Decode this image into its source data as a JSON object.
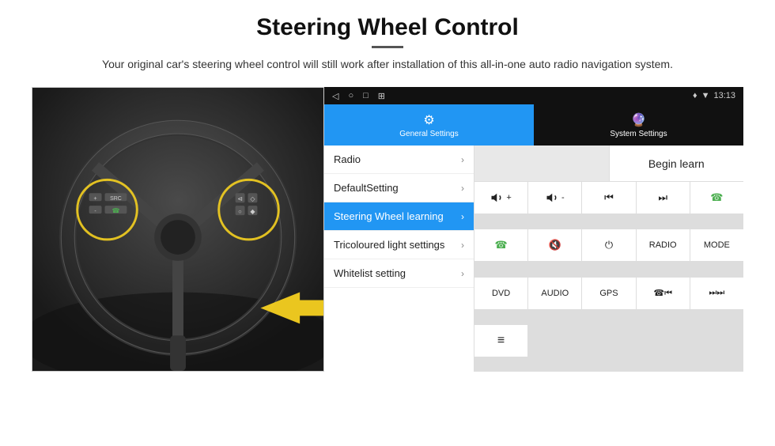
{
  "header": {
    "title": "Steering Wheel Control",
    "subtitle": "Your original car's steering wheel control will still work after installation of this all-in-one auto radio navigation system."
  },
  "status_bar": {
    "time": "13:13",
    "icons": [
      "◁",
      "○",
      "□",
      "⊞"
    ]
  },
  "tabs": [
    {
      "id": "general",
      "label": "General Settings",
      "active": true
    },
    {
      "id": "system",
      "label": "System Settings",
      "active": false
    }
  ],
  "menu_items": [
    {
      "id": "radio",
      "label": "Radio",
      "active": false
    },
    {
      "id": "default",
      "label": "DefaultSetting",
      "active": false
    },
    {
      "id": "steering",
      "label": "Steering Wheel learning",
      "active": true
    },
    {
      "id": "tricoloured",
      "label": "Tricoloured light settings",
      "active": false
    },
    {
      "id": "whitelist",
      "label": "Whitelist setting",
      "active": false
    }
  ],
  "begin_learn_label": "Begin learn",
  "button_grid_row1": [
    {
      "id": "vol_up",
      "symbol": "🔊+"
    },
    {
      "id": "vol_down",
      "symbol": "🔉-"
    },
    {
      "id": "prev_track",
      "symbol": "⏮"
    },
    {
      "id": "next_track",
      "symbol": "⏭"
    },
    {
      "id": "phone",
      "symbol": "📞"
    }
  ],
  "button_grid_row2": [
    {
      "id": "call",
      "symbol": "📞"
    },
    {
      "id": "mute",
      "symbol": "🔇"
    },
    {
      "id": "power",
      "symbol": "⏻"
    },
    {
      "id": "radio_btn",
      "symbol": "RADIO"
    },
    {
      "id": "mode",
      "symbol": "MODE"
    }
  ],
  "button_grid_row3": [
    {
      "id": "dvd",
      "symbol": "DVD"
    },
    {
      "id": "audio",
      "symbol": "AUDIO"
    },
    {
      "id": "gps",
      "symbol": "GPS"
    },
    {
      "id": "phone2",
      "symbol": "📞⏮"
    },
    {
      "id": "skip2",
      "symbol": "⏭⏭"
    }
  ],
  "button_grid_row4": [
    {
      "id": "list_icon",
      "symbol": "≡"
    }
  ]
}
